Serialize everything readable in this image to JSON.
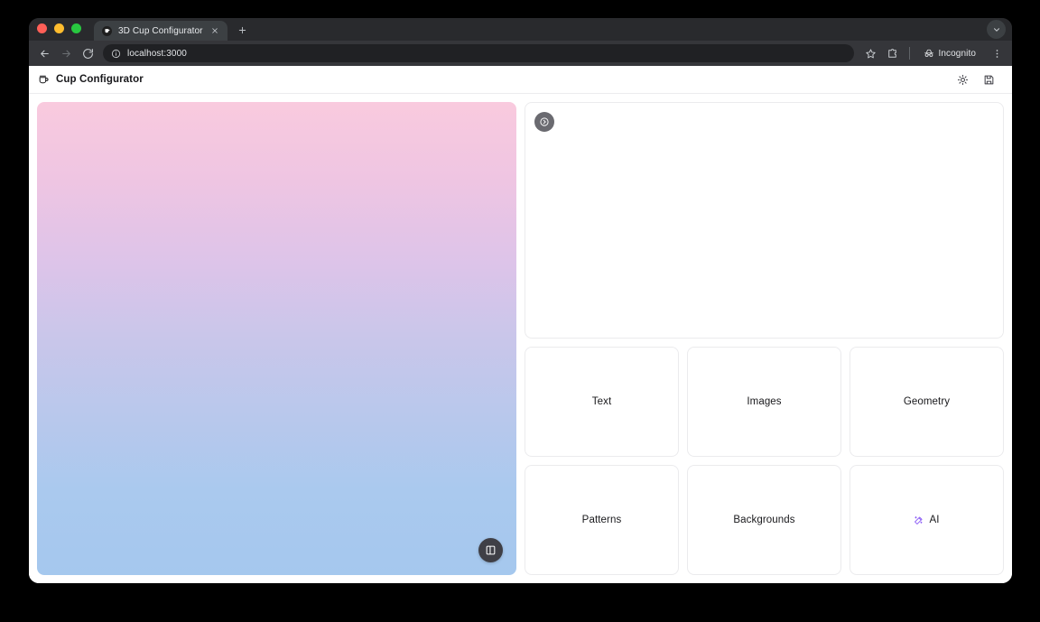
{
  "browser": {
    "tab": {
      "title": "3D Cup Configurator",
      "favicon_icon": "cup-favicon",
      "close_icon": "close-icon"
    },
    "new_tab_icon": "plus-icon",
    "tabstrip_menu_icon": "chevron-down-icon",
    "toolbar": {
      "back_icon": "arrow-left-icon",
      "forward_icon": "arrow-right-icon",
      "reload_icon": "reload-icon",
      "site_info_icon": "info-circle-icon",
      "url": "localhost:3000",
      "bookmark_icon": "star-icon",
      "extensions_icon": "puzzle-icon",
      "incognito_icon": "incognito-icon",
      "incognito_label": "Incognito",
      "menu_icon": "kebab-menu-icon"
    }
  },
  "app": {
    "header": {
      "logo_icon": "coffee-cup-icon",
      "title": "Cup Configurator",
      "actions": [
        {
          "name": "theme-toggle",
          "icon": "sun-icon"
        },
        {
          "name": "save-design",
          "icon": "save-icon"
        }
      ]
    },
    "canvas": {
      "gradient_top": "#f9cade",
      "gradient_mid": "#c9c6ea",
      "gradient_bottom": "#a5c8ee",
      "fab_icon": "panel-toggle-icon"
    },
    "preview": {
      "fab_icon": "chevron-right-circle-icon"
    },
    "tools": [
      {
        "label": "Text",
        "icon": null
      },
      {
        "label": "Images",
        "icon": null
      },
      {
        "label": "Geometry",
        "icon": null
      },
      {
        "label": "Patterns",
        "icon": null
      },
      {
        "label": "Backgrounds",
        "icon": null
      },
      {
        "label": "AI",
        "icon": "sparkle-wand-icon",
        "icon_color": "#8b5cf6"
      }
    ]
  }
}
